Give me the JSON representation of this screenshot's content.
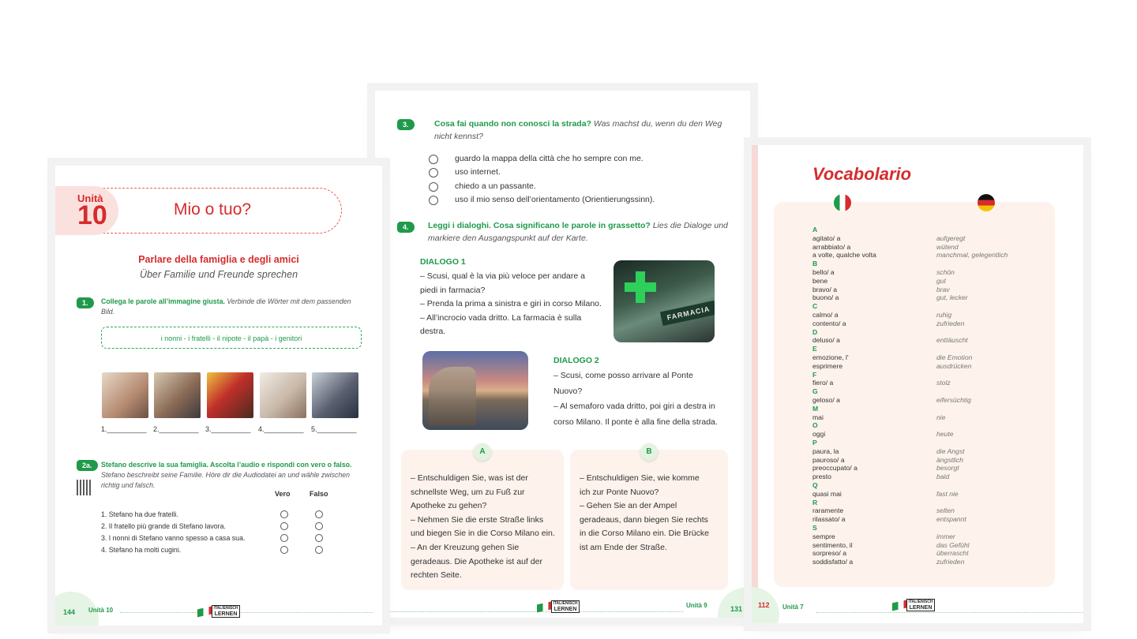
{
  "left_page": {
    "unit_word": "Unità",
    "unit_number": "10",
    "title": "Mio o tuo?",
    "subtitle_it": "Parlare della famiglia e degli amici",
    "subtitle_de": "Über Familie und Freunde sprechen",
    "ex1": {
      "number": "1.",
      "title_it": "Collega le parole all’immagine giusta.",
      "title_de": "Verbinde die Wörter mit dem passenden Bild.",
      "words": "i nonni - i fratelli - il nipote - il papà - i genitori",
      "blanks": [
        "1.__________",
        "2.__________",
        "3.__________",
        "4.__________",
        "5.__________"
      ]
    },
    "ex2a": {
      "number": "2a.",
      "title_it": "Stefano descrive la sua famiglia. Ascolta l’audio e rispondi con vero o falso.",
      "title_de": "Stefano beschreibt seine Familie. Höre dir die Audiodatei an und wähle zwischen richtig und falsch.",
      "col_true": "Vero",
      "col_false": "Falso",
      "statements": [
        "1. Stefano ha due fratelli.",
        "2. Il fratello più grande di Stefano lavora.",
        "3. I nonni di Stefano vanno spesso a casa sua.",
        "4. Stefano ha molti cugini."
      ]
    },
    "footer": {
      "page": "144",
      "unit": "Unità 10"
    }
  },
  "center_page": {
    "ex3": {
      "number": "3.",
      "title_it": "Cosa fai quando non conosci la strada?",
      "title_de": "Was machst du, wenn du den Weg nicht kennst?",
      "options": [
        "guardo la mappa della città che ho sempre con me.",
        "uso internet.",
        "chiedo a un passante.",
        "uso il mio senso dell’orientamento (Orientierungssinn)."
      ]
    },
    "ex4": {
      "number": "4.",
      "title_it": "Leggi i dialoghi. Cosa significano le parole in grassetto?",
      "title_de": "Lies die Dialoge und markiere den Ausgangspunkt auf der Karte."
    },
    "dialog1": {
      "title": "DIALOGO 1",
      "lines": [
        "– Scusi, qual è la via più veloce per andare a",
        "piedi in farmacia?",
        "– Prenda la prima a sinistra e giri in corso Milano.",
        "– All’incrocio vada dritto. La farmacia è sulla",
        "destra."
      ]
    },
    "dialog2": {
      "title": "DIALOGO 2",
      "lines": [
        "– Scusi, come posso arrivare al Ponte",
        "Nuovo?",
        "– Al semaforo vada dritto, poi giri  a destra in",
        "corso Milano. Il ponte è alla fine della strada."
      ]
    },
    "farmacia_sign": "FARMACIA",
    "card_a": {
      "label": "A",
      "lines": [
        "– Entschuldigen Sie, was ist der",
        "schnellste Weg, um zu Fuß zur",
        "Apotheke zu gehen?",
        "– Nehmen Sie die erste Straße links",
        "und biegen Sie in die Corso Milano ein.",
        "– An der Kreuzung gehen Sie",
        "geradeaus. Die Apotheke ist auf der",
        "rechten Seite."
      ]
    },
    "card_b": {
      "label": "B",
      "lines": [
        "– Entschuldigen Sie, wie komme",
        "ich zur Ponte Nuovo?",
        "– Gehen Sie an der Ampel",
        "geradeaus, dann biegen Sie rechts",
        "in die Corso Milano ein. Die Brücke",
        "ist am Ende der Straße."
      ]
    },
    "footer": {
      "unit": "Unità 9",
      "page": "131"
    }
  },
  "right_page": {
    "title": "Vocabolario",
    "entries": [
      {
        "letter": "A"
      },
      {
        "it": "agitato/ a",
        "de": "aufgeregt"
      },
      {
        "it": "arrabbiato/ a",
        "de": "wütend"
      },
      {
        "it": "a volte, qualche volta",
        "de": "manchmal, gelegentlich"
      },
      {
        "letter": "B"
      },
      {
        "it": "bello/ a",
        "de": "schön"
      },
      {
        "it": "bene",
        "de": "gut"
      },
      {
        "it": "bravo/ a",
        "de": "brav"
      },
      {
        "it": "buono/ a",
        "de": "gut, lecker"
      },
      {
        "letter": "C"
      },
      {
        "it": "calmo/ a",
        "de": "ruhig"
      },
      {
        "it": "contento/ a",
        "de": "zufrieden"
      },
      {
        "letter": "D"
      },
      {
        "it": "deluso/ a",
        "de": "enttäuscht"
      },
      {
        "letter": "E"
      },
      {
        "it": "emozione, l'",
        "de": "die Emotion"
      },
      {
        "it": "esprimere",
        "de": "ausdrücken"
      },
      {
        "letter": "F"
      },
      {
        "it": "fiero/ a",
        "de": "stolz"
      },
      {
        "letter": "G"
      },
      {
        "it": "geloso/ a",
        "de": "eifersüchtig"
      },
      {
        "letter": "M"
      },
      {
        "it": "mai",
        "de": "nie"
      },
      {
        "letter": "O"
      },
      {
        "it": "oggi",
        "de": "heute"
      },
      {
        "letter": "P"
      },
      {
        "it": "paura, la",
        "de": "die Angst"
      },
      {
        "it": "pauroso/ a",
        "de": "ängstlich"
      },
      {
        "it": "preoccupato/ a",
        "de": "besorgt"
      },
      {
        "it": "presto",
        "de": "bald"
      },
      {
        "letter": "Q"
      },
      {
        "it": "quasi mai",
        "de": "fast nie"
      },
      {
        "letter": "R"
      },
      {
        "it": "raramente",
        "de": "selten"
      },
      {
        "it": "rilassato/ a",
        "de": "entspannt"
      },
      {
        "letter": "S"
      },
      {
        "it": "sempre",
        "de": "immer"
      },
      {
        "it": "sentimento, il",
        "de": "das Gefühl"
      },
      {
        "it": "sorpreso/ a",
        "de": "überrascht"
      },
      {
        "it": "soddisfatto/ a",
        "de": "zufrieden"
      }
    ],
    "footer": {
      "page": "112",
      "unit": "Unità 7"
    }
  },
  "logo": {
    "line1": "ITALIENISCH",
    "line2": "LERNEN"
  },
  "colors": {
    "green": "#1f9a4a",
    "red": "#d62c2c",
    "card_bg": "#fdf2ec"
  }
}
